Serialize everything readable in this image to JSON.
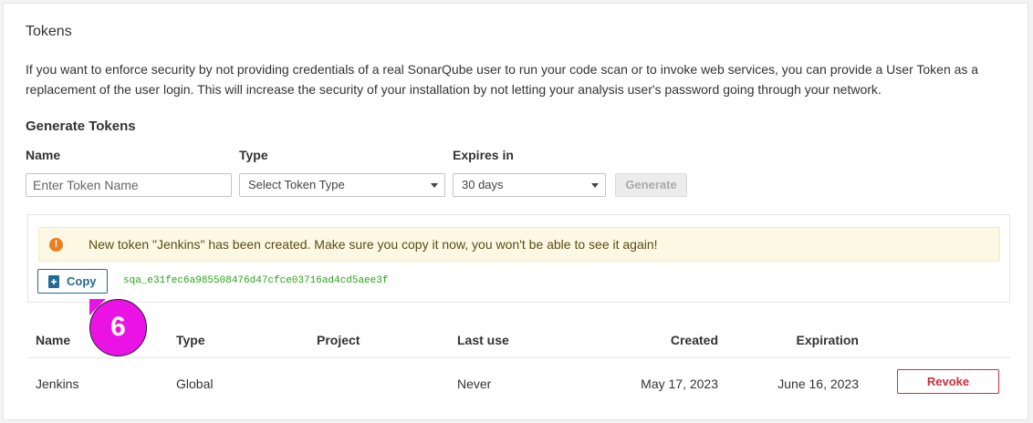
{
  "section": {
    "title": "Tokens",
    "description": "If you want to enforce security by not providing credentials of a real SonarQube user to run your code scan or to invoke web services, you can provide a User Token as a replacement of the user login. This will increase the security of your installation by not letting your analysis user's password going through your network."
  },
  "generate": {
    "title": "Generate Tokens",
    "name_label": "Name",
    "name_placeholder": "Enter Token Name",
    "type_label": "Type",
    "type_value": "Select Token Type",
    "expires_label": "Expires in",
    "expires_value": "30 days",
    "generate_label": "Generate"
  },
  "token_created": {
    "warning_icon": "!",
    "message": "New token \"Jenkins\" has been created. Make sure you copy it now, you won't be able to see it again!",
    "copy_label": "Copy",
    "token_value": "sqa_e31fec6a985508476d47cfce03716ad4cd5aee3f"
  },
  "step_marker": "6",
  "table": {
    "headers": {
      "name": "Name",
      "type": "Type",
      "project": "Project",
      "last_use": "Last use",
      "created": "Created",
      "expiration": "Expiration"
    },
    "rows": [
      {
        "name": "Jenkins",
        "type": "Global",
        "project": "",
        "last_use": "Never",
        "created": "May 17, 2023",
        "expiration": "June 16, 2023",
        "action": "Revoke"
      }
    ]
  },
  "colors": {
    "primary": "#236a97",
    "danger": "#d02f3a",
    "warning_bg": "#fcf8e3",
    "token_text": "#29a519",
    "marker": "#ea12e5"
  }
}
